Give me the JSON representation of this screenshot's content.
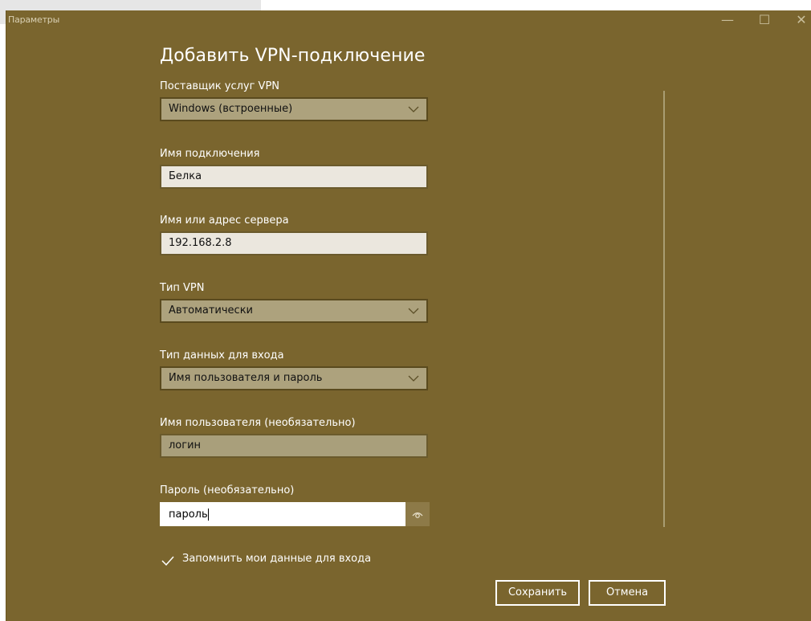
{
  "window": {
    "title": "Параметры",
    "min_glyph": "—",
    "max_glyph": "☐",
    "close_glyph": "✕"
  },
  "page": {
    "title": "Добавить VPN-подключение"
  },
  "form": {
    "provider": {
      "label": "Поставщик услуг VPN",
      "value": "Windows (встроенные)"
    },
    "connection_name": {
      "label": "Имя подключения",
      "value": "Белка"
    },
    "server": {
      "label": "Имя или адрес сервера",
      "value": "192.168.2.8"
    },
    "vpn_type": {
      "label": "Тип VPN",
      "value": "Автоматически"
    },
    "signin_type": {
      "label": "Тип данных для входа",
      "value": "Имя пользователя и пароль"
    },
    "username": {
      "label": "Имя пользователя (необязательно)",
      "value": "логин"
    },
    "password": {
      "label": "Пароль (необязательно)",
      "value": "пароль"
    },
    "remember": {
      "label": "Запомнить мои данные для входа",
      "checked": true
    }
  },
  "actions": {
    "save_label": "Сохранить",
    "cancel_label": "Отмена"
  },
  "icons": {
    "reveal": "eye-icon",
    "dropdown": "chevron-down-icon",
    "check": "checkmark-icon"
  },
  "colors": {
    "window_bg": "#7a652e",
    "select_bg": "#ada27d",
    "input_bg": "#ebe7de",
    "accent_text": "#ffffff"
  }
}
